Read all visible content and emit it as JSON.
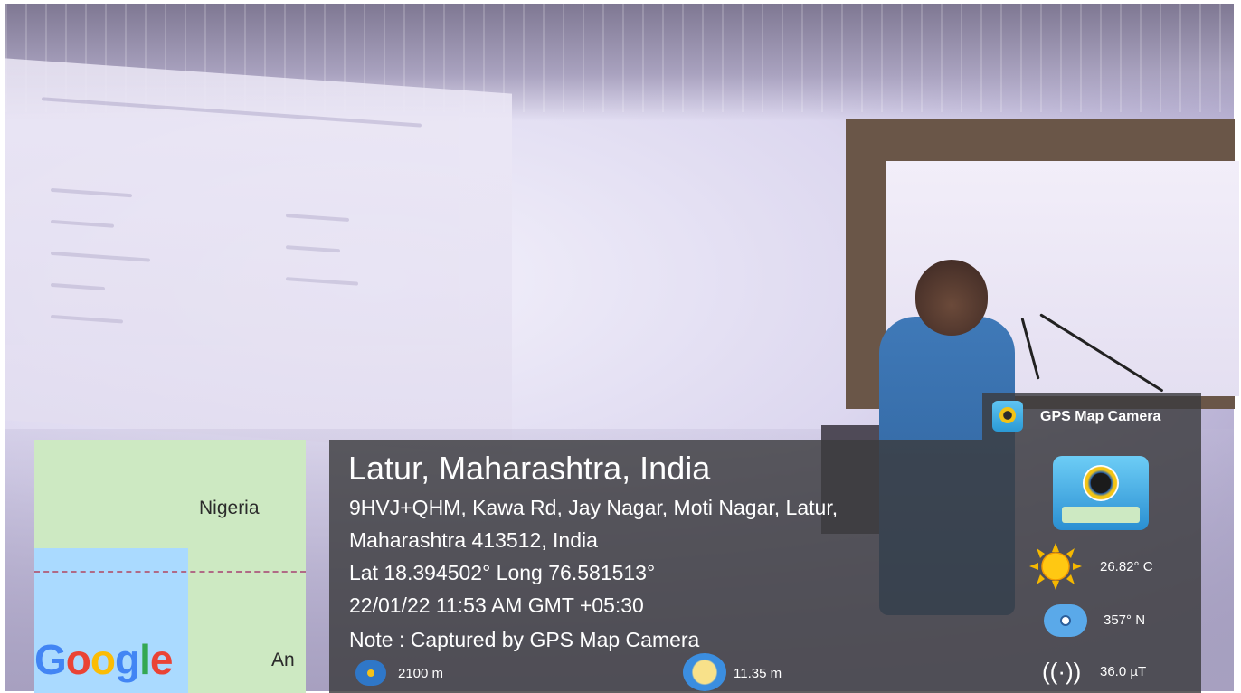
{
  "overlay": {
    "brand": "GPS Map Camera",
    "location_title": "Latur, Maharashtra, India",
    "address_line1": "9HVJ+QHM, Kawa Rd, Jay Nagar, Moti Nagar, Latur,",
    "address_line2": "Maharashtra 413512, India",
    "coordinates": "Lat 18.394502° Long 76.581513°",
    "datetime": "22/01/22 11:53 AM GMT +05:30",
    "note": "Note : Captured by GPS Map Camera",
    "accuracy": "2100 m",
    "altitude": "11.35 m",
    "temperature": "26.82° C",
    "heading": "357° N",
    "magnetic_field": "36.0 µT"
  },
  "map": {
    "label_country": "Nigeria",
    "label_partial": "An",
    "logo": "Google"
  },
  "colors": {
    "panel": "#3c3c3e",
    "map_water": "#aadaff",
    "map_land": "#cde9c2",
    "shirt": "#3f79b8"
  },
  "icons": [
    "gps-map-camera-icon",
    "sun-icon",
    "compass-icon",
    "magnet-icon",
    "accuracy-icon",
    "altitude-icon"
  ]
}
